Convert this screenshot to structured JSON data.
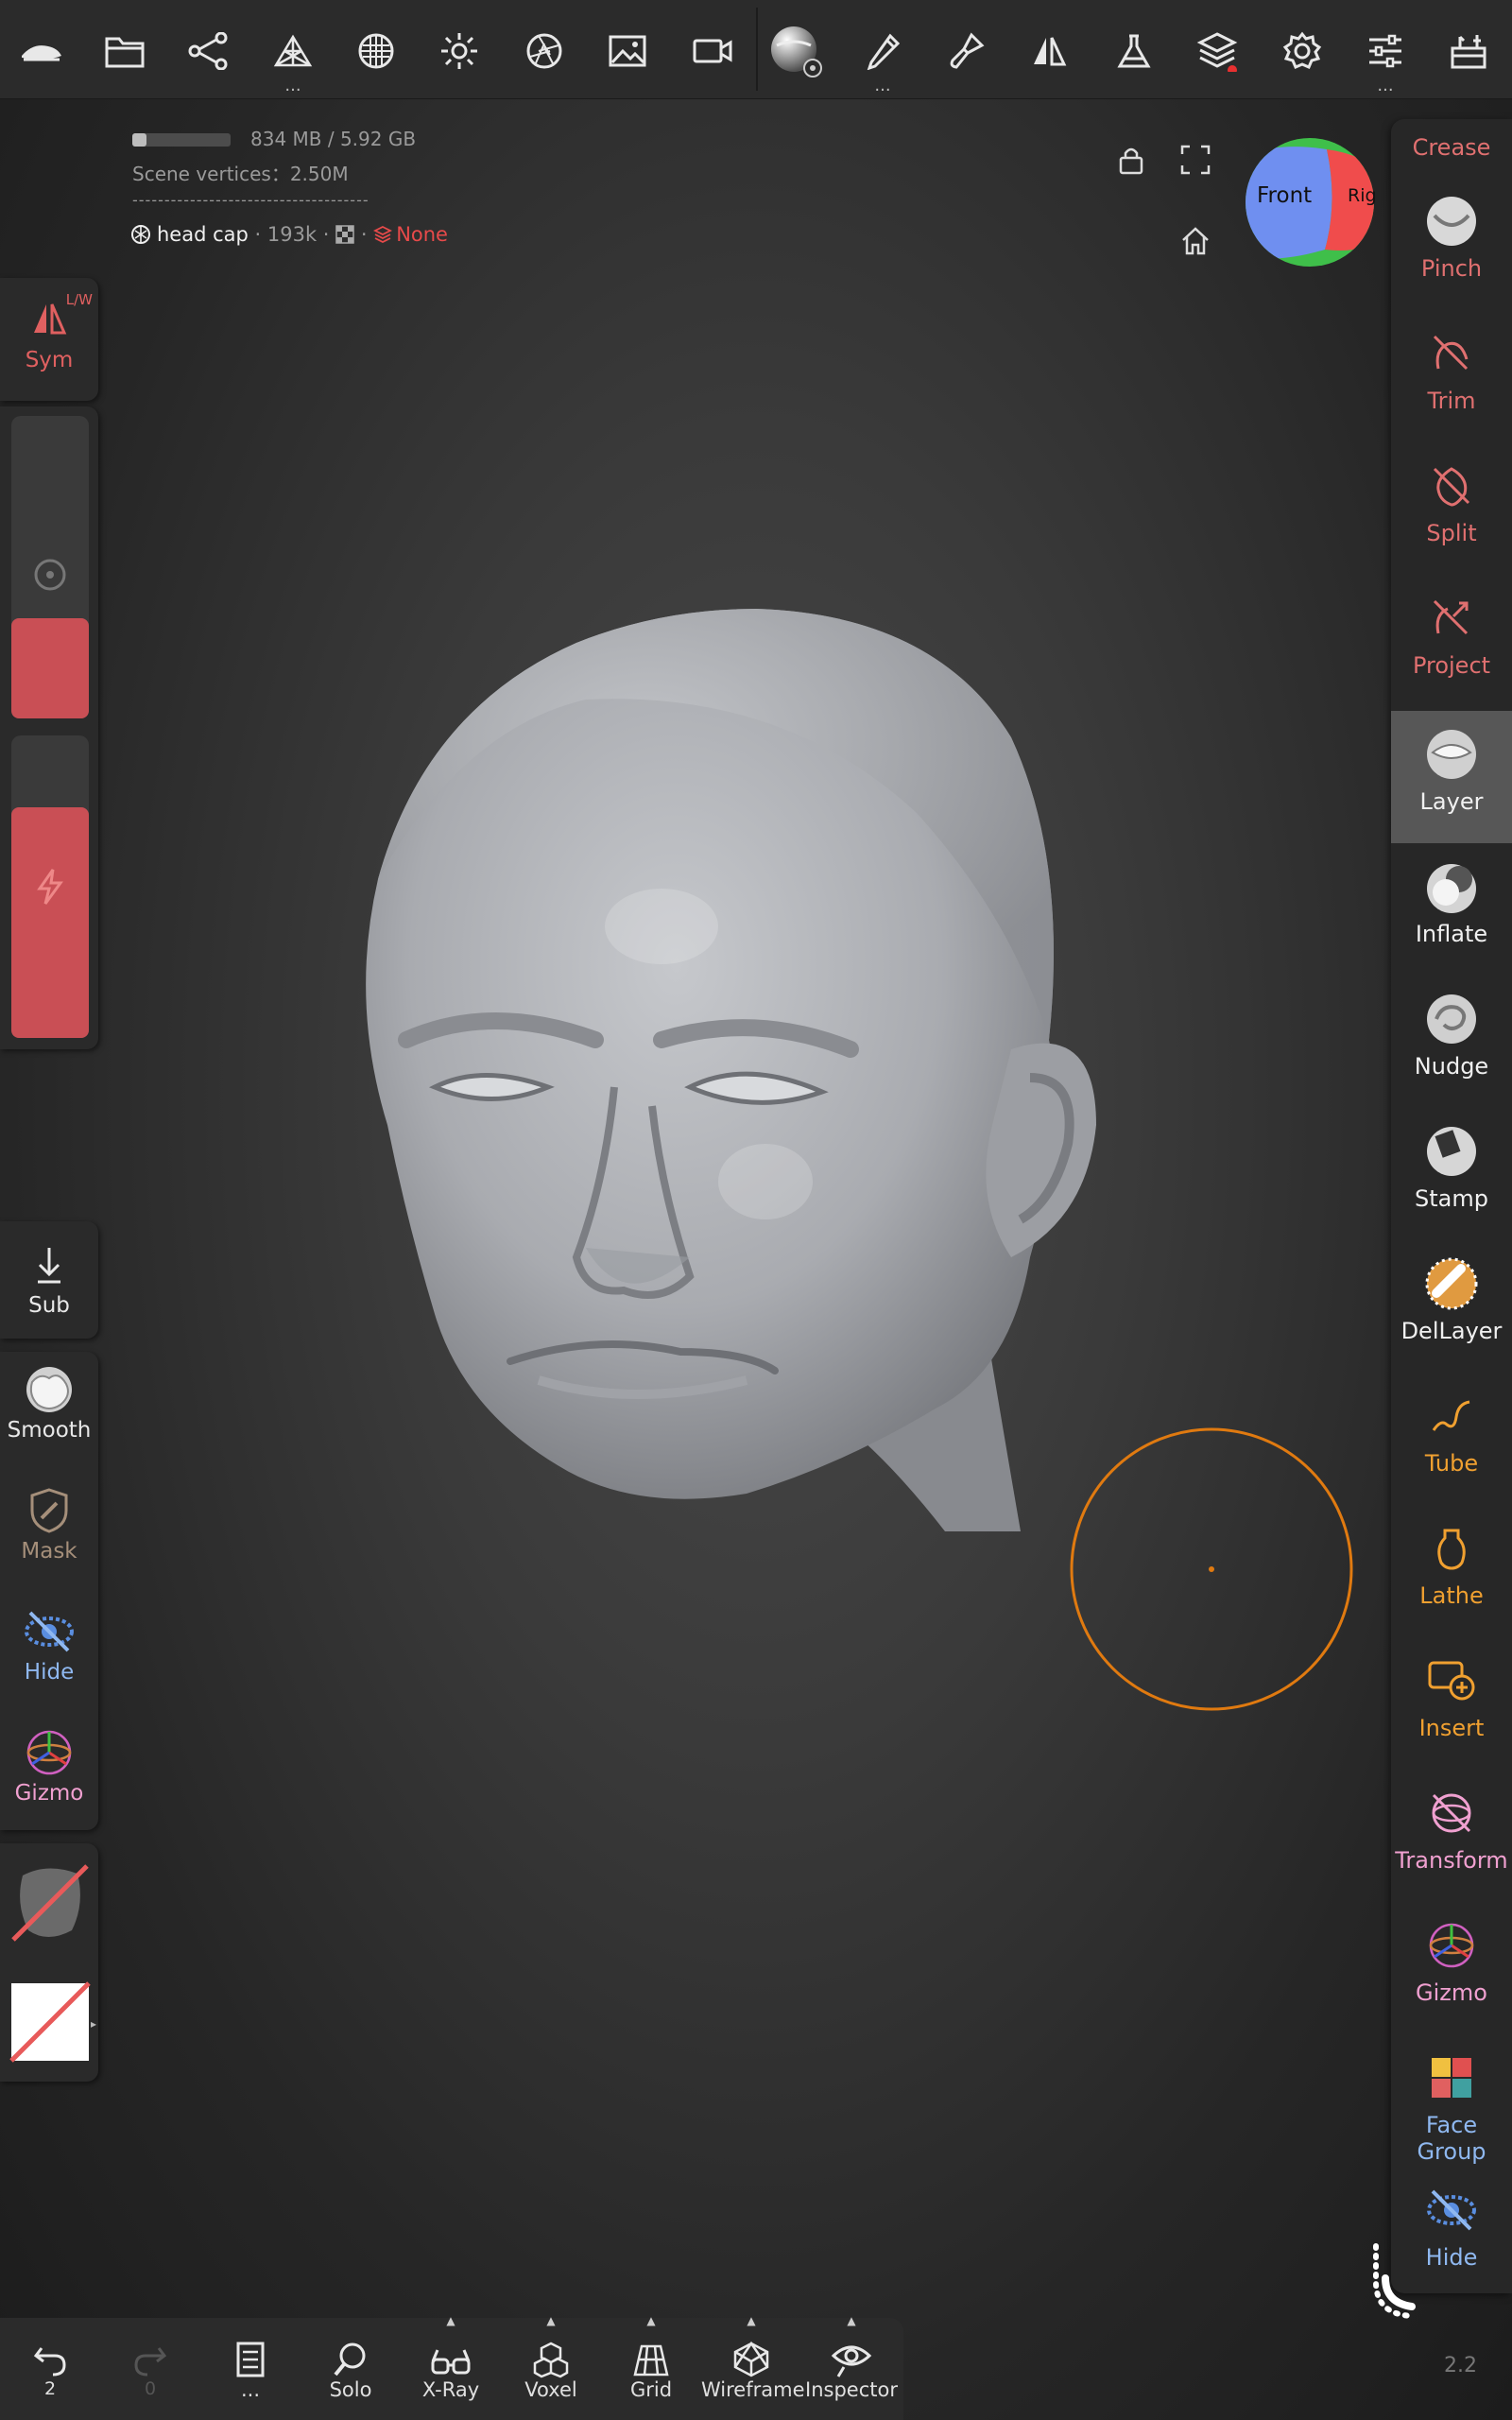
{
  "stats": {
    "memory": "834 MB / 5.92 GB",
    "memory_fraction": 0.14,
    "scene_vertices": "Scene vertices：2.50M",
    "divider": "-------------------------------------",
    "mesh_name": "head cap",
    "mesh_count": " · 193k · ",
    "layer_sep": " · ",
    "layer_value": "None"
  },
  "top_toolbar": {
    "dots": "..."
  },
  "view_cube": {
    "front_label": "Front",
    "right_label": "Rig"
  },
  "left_panel": {
    "sym_label": "Sym",
    "sym_badge": "L/W",
    "sub_label": "Sub",
    "smooth_label": "Smooth",
    "mask_label": "Mask",
    "hide_label": "Hide",
    "gizmo_label": "Gizmo"
  },
  "right_tools": [
    {
      "label": "Crease"
    },
    {
      "label": "Pinch"
    },
    {
      "label": "Trim"
    },
    {
      "label": "Split"
    },
    {
      "label": "Project"
    },
    {
      "label": "Layer"
    },
    {
      "label": "Inflate"
    },
    {
      "label": "Nudge"
    },
    {
      "label": "Stamp"
    },
    {
      "label": "DelLayer"
    },
    {
      "label": "Tube"
    },
    {
      "label": "Lathe"
    },
    {
      "label": "Insert"
    },
    {
      "label": "Transform"
    },
    {
      "label": "Gizmo"
    },
    {
      "label": "Face Group"
    },
    {
      "label": "Hide"
    }
  ],
  "bottom_bar": {
    "undo_count": "2",
    "redo_count": "0",
    "more_label": "...",
    "solo_label": "Solo",
    "xray_label": "X-Ray",
    "voxel_label": "Voxel",
    "grid_label": "Grid",
    "wireframe_label": "Wireframe",
    "inspector_label": "Inspector",
    "caret": "▲"
  },
  "version": "2.2",
  "colors": {
    "crease": "#e07070",
    "sym": "#e06060",
    "mask": "#a58f7a",
    "hide_blue": "#8fb8f0",
    "gizmo_pink": "#f0a0d0",
    "tube_orange": "#f0a030",
    "brush_cursor": "#e07a10"
  }
}
